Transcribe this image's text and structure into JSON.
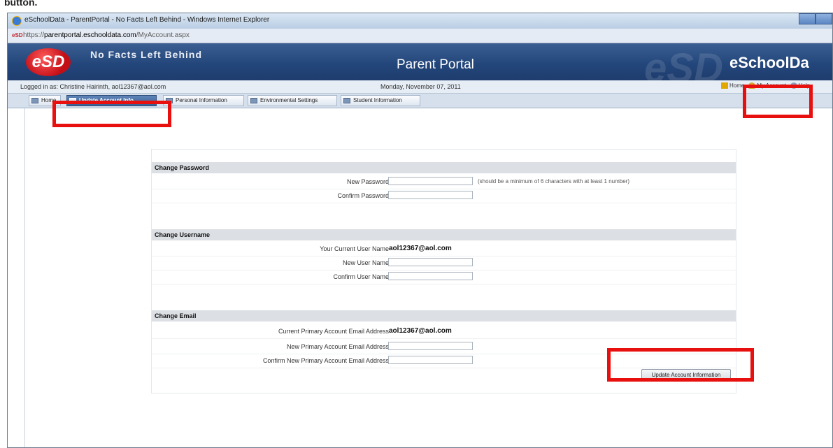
{
  "doc_fragment": "button.",
  "window": {
    "title": "eSchoolData - ParentPortal - No Facts Left Behind - Windows Internet Explorer",
    "favicon_text": "eSD",
    "url_prefix": "https://",
    "url_host": "parentportal.eschooldata.com",
    "url_path": "/MyAccount.aspx"
  },
  "header": {
    "logo": "eSD",
    "tagline": "No Facts Left Behind",
    "title": "Parent Portal",
    "watermark": "eSD",
    "brand": "eSchoolDa"
  },
  "infobar": {
    "logged_in": "Logged in as: Christine Hairinth, aol12367@aol.com",
    "date": "Monday, November 07, 2011",
    "links": {
      "home": "Home",
      "my_account": "My Account",
      "help": "Help"
    }
  },
  "tabs": [
    {
      "label": "Home"
    },
    {
      "label": "Update Account Info"
    },
    {
      "label": "Personal Information"
    },
    {
      "label": "Environmental Settings"
    },
    {
      "label": "Student Information"
    }
  ],
  "form": {
    "password": {
      "heading": "Change Password",
      "new_label": "New Password",
      "new_hint": "(should be a minimum of 6 characters with at least 1 number)",
      "confirm_label": "Confirm Password"
    },
    "username": {
      "heading": "Change Username",
      "current_label": "Your Current User Name",
      "current_value": "aol12367@aol.com",
      "new_label": "New User Name",
      "confirm_label": "Confirm User Name"
    },
    "email": {
      "heading": "Change Email",
      "current_label": "Current Primary Account Email Address",
      "current_value": "aol12367@aol.com",
      "new_label": "New Primary Account Email Address",
      "confirm_label": "Confirm New Primary Account Email Address"
    },
    "submit_label": "Update Account Information"
  },
  "colors": {
    "header_blue": "#23467b",
    "highlight_red": "#e8100e",
    "section_gray": "#dcdfe3"
  }
}
